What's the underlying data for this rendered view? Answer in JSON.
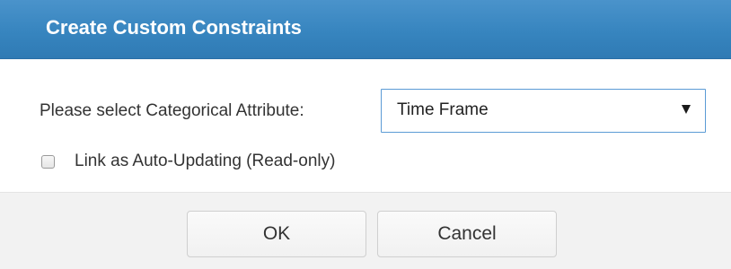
{
  "dialog": {
    "title": "Create Custom Constraints",
    "select_label": "Please select Categorical Attribute:",
    "select_value": "Time Frame",
    "checkbox_label": "Link as Auto-Updating (Read-only)",
    "checkbox_checked": false,
    "ok_label": "OK",
    "cancel_label": "Cancel"
  },
  "icons": {
    "dropdown": "chevron-down-icon"
  },
  "colors": {
    "titlebar": "#3785bf",
    "select_border": "#5b9bd5",
    "footer": "#f2f2f2"
  }
}
